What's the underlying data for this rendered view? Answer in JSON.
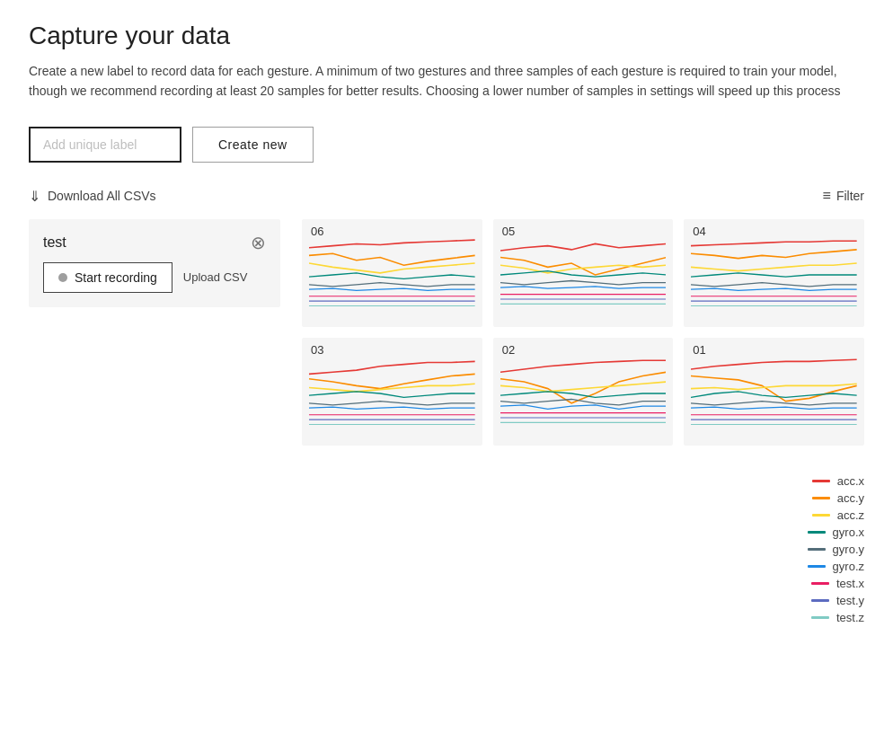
{
  "page": {
    "title": "Capture your data",
    "description": "Create a new label to record data for each gesture. A minimum of two gestures and three samples of each gesture is required to train your model, though we recommend recording at least 20 samples for better results. Choosing a lower number of samples in settings will speed up this process"
  },
  "controls": {
    "label_input_placeholder": "Add unique label",
    "create_new_label": "Create new"
  },
  "toolbar": {
    "download_label": "Download All CSVs",
    "filter_label": "Filter"
  },
  "label_card": {
    "name": "test",
    "record_button": "Start recording",
    "upload_label": "Upload CSV"
  },
  "charts": [
    {
      "id": "chart-06",
      "label": "06"
    },
    {
      "id": "chart-05",
      "label": "05"
    },
    {
      "id": "chart-04",
      "label": "04"
    },
    {
      "id": "chart-03",
      "label": "03"
    },
    {
      "id": "chart-02",
      "label": "02"
    },
    {
      "id": "chart-01",
      "label": "01"
    }
  ],
  "legend": [
    {
      "key": "acc.x",
      "color": "#e53935"
    },
    {
      "key": "acc.y",
      "color": "#fb8c00"
    },
    {
      "key": "acc.z",
      "color": "#fdd835"
    },
    {
      "key": "gyro.x",
      "color": "#00897b"
    },
    {
      "key": "gyro.y",
      "color": "#546e7a"
    },
    {
      "key": "gyro.z",
      "color": "#1e88e5"
    },
    {
      "key": "test.x",
      "color": "#e91e63"
    },
    {
      "key": "test.y",
      "color": "#5c6bc0"
    },
    {
      "key": "test.z",
      "color": "#80cbc4"
    }
  ]
}
